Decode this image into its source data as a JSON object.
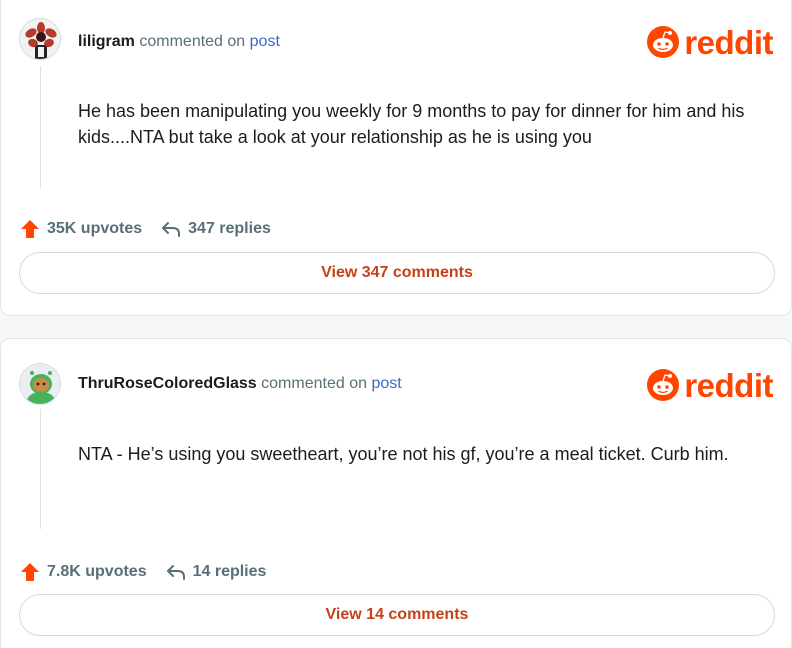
{
  "colors": {
    "brand": "#ff4500",
    "link": "#3a6bc4",
    "meta": "#576f76",
    "button_text": "#c4421a"
  },
  "comments": [
    {
      "username": "liligram",
      "commented_on": "commented on",
      "post_link": "post",
      "logo_text": "reddit",
      "text": "He has been manipulating you weekly for 9 months to pay for dinner for him and his kids....NTA but take a look at your relationship as he is using you",
      "upvotes": "35K upvotes",
      "replies": "347 replies",
      "view_button": "View 347 comments",
      "avatar_icon": "red-flower-creature-avatar"
    },
    {
      "username": "ThruRoseColoredGlass",
      "commented_on": "commented on",
      "post_link": "post",
      "logo_text": "reddit",
      "text": "NTA - He’s using you sweetheart, you’re not his gf, you’re a meal ticket. Curb him.",
      "upvotes": "7.8K upvotes",
      "replies": "14 replies",
      "view_button": "View 14 comments",
      "avatar_icon": "snoo-green-hoodie-avatar"
    }
  ]
}
